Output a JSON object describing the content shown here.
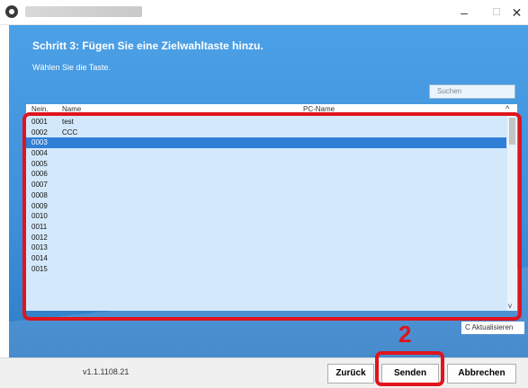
{
  "window": {
    "title": "",
    "minimize": "–",
    "maximize": "☐",
    "close": "✕"
  },
  "step": {
    "title": "Schritt 3: Fügen Sie eine Zielwahltaste hinzu.",
    "subtitle": "Wählen Sie die Taste."
  },
  "search": {
    "placeholder": "Suchen"
  },
  "table": {
    "columns": [
      "Nein.",
      "Name",
      "PC-Name"
    ],
    "sort_indicator": "^",
    "scroll_down": "v",
    "rows": [
      {
        "no": "0001",
        "name": "test"
      },
      {
        "no": "0002",
        "name": "CCC"
      },
      {
        "no": "0003",
        "name": ""
      },
      {
        "no": "0004",
        "name": ""
      },
      {
        "no": "0005",
        "name": ""
      },
      {
        "no": "0006",
        "name": ""
      },
      {
        "no": "0007",
        "name": ""
      },
      {
        "no": "0008",
        "name": ""
      },
      {
        "no": "0009",
        "name": ""
      },
      {
        "no": "0010",
        "name": ""
      },
      {
        "no": "0011",
        "name": ""
      },
      {
        "no": "0012",
        "name": ""
      },
      {
        "no": "0013",
        "name": ""
      },
      {
        "no": "0014",
        "name": ""
      },
      {
        "no": "0015",
        "name": ""
      }
    ],
    "selected": "0003"
  },
  "refresh": {
    "label": "C Aktualisieren"
  },
  "footer": {
    "version": "v1.1.1108.21",
    "back": "Zurück",
    "send": "Senden",
    "cancel": "Abbrechen"
  },
  "annotation": {
    "step_marker": "2"
  },
  "colors": {
    "highlight": "#e0141d",
    "selection": "#2f7fd6",
    "background": "#3e8fd8"
  }
}
